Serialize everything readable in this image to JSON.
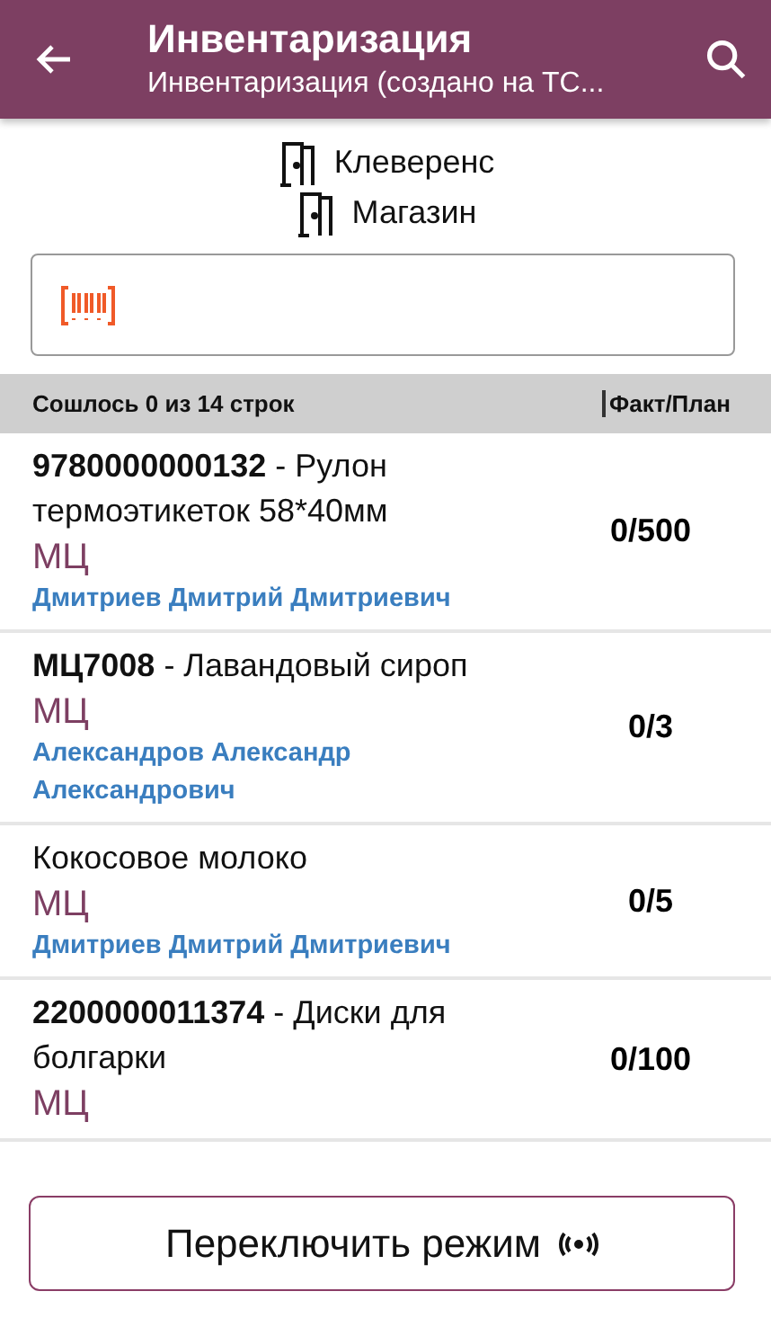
{
  "header": {
    "title": "Инвентаризация",
    "subtitle": "Инвентаризация (создано на ТС..."
  },
  "locations": [
    "Клеверенс",
    "Магазин"
  ],
  "summary": {
    "matched": "Сошлось 0 из 14 строк",
    "column": "Факт/План"
  },
  "rows": [
    {
      "name": "**9780000000132** - Рулон термоэтикеток 58*40мм",
      "unit": "МЦ",
      "person": "Дмитриев Дмитрий Дмитриевич",
      "qty": "0/500"
    },
    {
      "name": "**МЦ7008** - Лавандовый сироп",
      "unit": "МЦ",
      "person": "Александров Александр Александрович",
      "qty": "0/3"
    },
    {
      "name": "Кокосовое молоко",
      "unit": "МЦ",
      "person": "Дмитриев Дмитрий Дмитриевич",
      "qty": "0/5"
    },
    {
      "name": "**2200000011374** - Диски для болгарки",
      "unit": "МЦ",
      "qty": "0/100"
    }
  ],
  "mode_button": {
    "label": "Переключить режим"
  }
}
